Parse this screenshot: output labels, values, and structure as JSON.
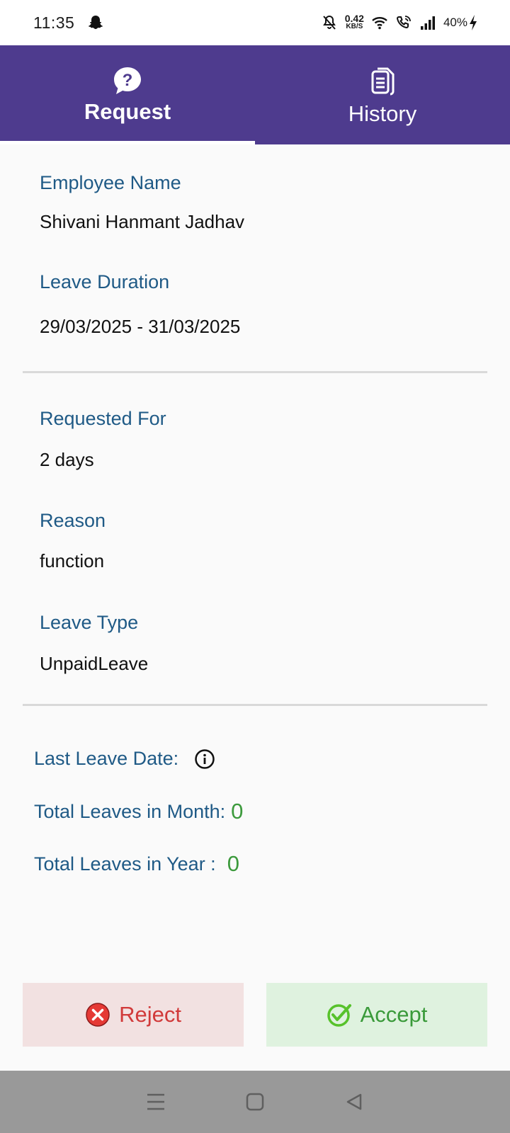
{
  "status_bar": {
    "time": "11:35",
    "speed_value": "0.42",
    "speed_unit": "KB/S",
    "battery": "40%"
  },
  "tabs": [
    {
      "label": "Request",
      "icon": "question-bubble-icon",
      "active": true
    },
    {
      "label": "History",
      "icon": "document-icon",
      "active": false
    }
  ],
  "details": {
    "employee_name_label": "Employee Name",
    "employee_name": "Shivani Hanmant Jadhav",
    "leave_duration_label": "Leave Duration",
    "leave_duration": "29/03/2025 - 31/03/2025",
    "requested_for_label": "Requested For",
    "requested_for": "2 days",
    "reason_label": "Reason",
    "reason": "function",
    "leave_type_label": "Leave Type",
    "leave_type": "UnpaidLeave"
  },
  "stats": {
    "last_leave_label": "Last Leave Date:",
    "month_label": "Total Leaves in Month:",
    "month_value": "0",
    "year_label": "Total Leaves in Year :",
    "year_value": "0"
  },
  "actions": {
    "reject_label": "Reject",
    "accept_label": "Accept"
  },
  "colors": {
    "header": "#4e3b8e",
    "label": "#1f5a86",
    "reject": "#d13a3a",
    "accept": "#3a9a3a"
  }
}
